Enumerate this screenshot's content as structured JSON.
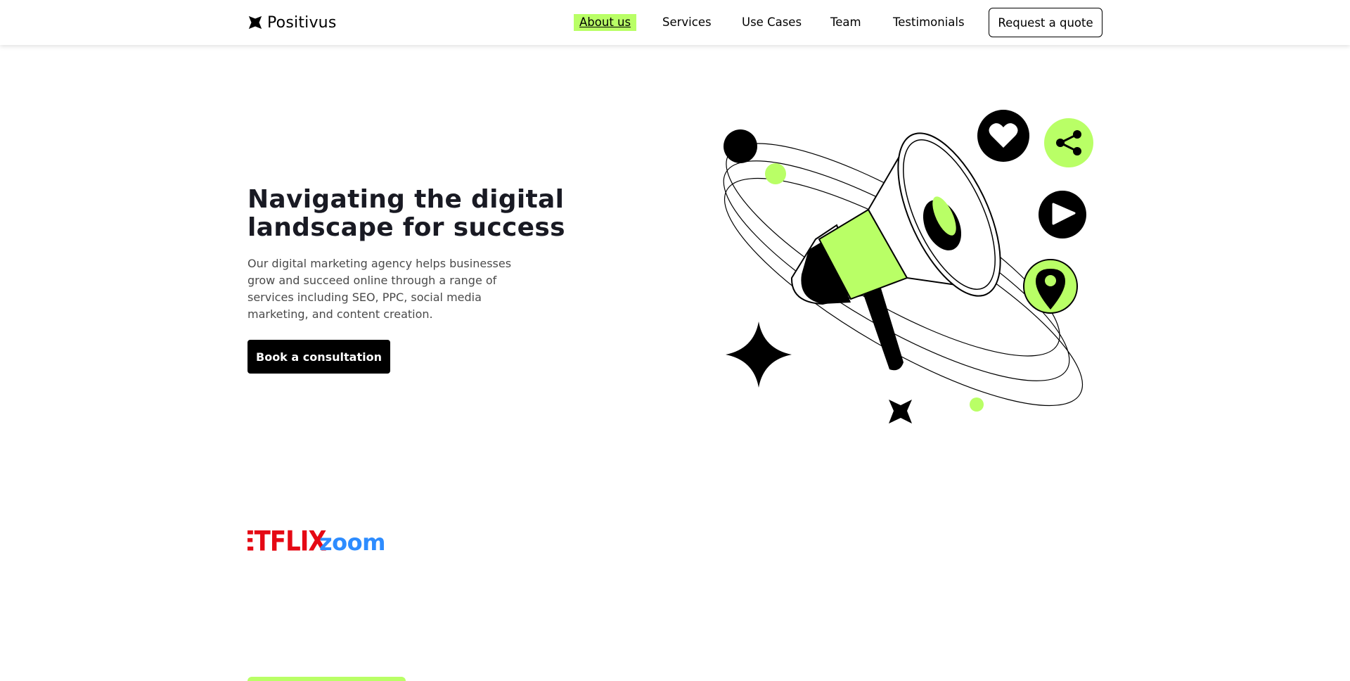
{
  "header": {
    "brand": "Positivus",
    "nav": [
      {
        "label": "About us",
        "active": true
      },
      {
        "label": "Services",
        "active": false
      },
      {
        "label": "Use Cases",
        "active": false
      },
      {
        "label": "Team",
        "active": false
      },
      {
        "label": "Testimonials",
        "active": false
      }
    ],
    "quote_button": "Request a quote"
  },
  "hero": {
    "title_line1": "Navigating the digital",
    "title_line2": "landscape for success",
    "description": "Our digital marketing agency helps businesses grow and succeed online through a range of services including SEO, PPC, social media marketing, and content creation.",
    "cta_button": "Book a consultation"
  },
  "logos": [
    "NETFLIX",
    "zoom"
  ],
  "colors": {
    "accent": "#b9ff66",
    "dark": "#191a23",
    "netflix": "#e50914",
    "zoom": "#2d8cff"
  },
  "icons": [
    "positivus-logo-icon",
    "heart-icon",
    "share-icon",
    "play-icon",
    "location-pin-icon",
    "megaphone-icon",
    "sparkle-star-icon"
  ]
}
